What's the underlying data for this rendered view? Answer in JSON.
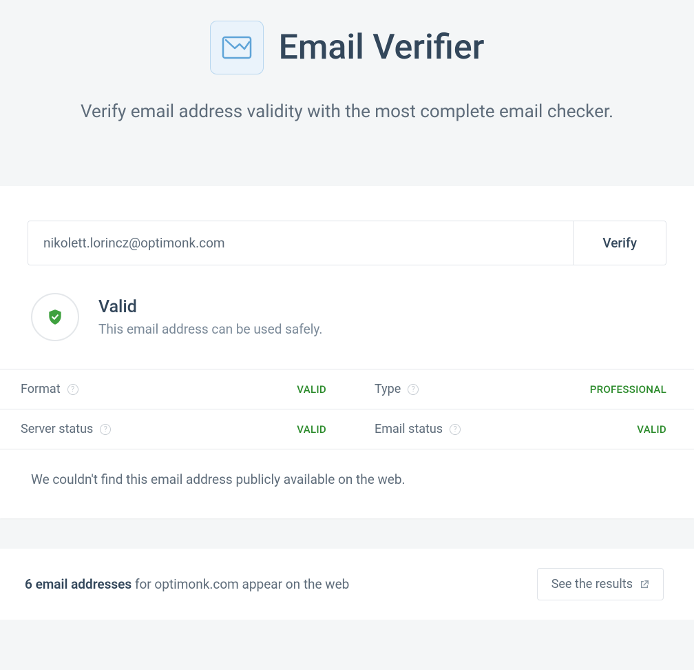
{
  "hero": {
    "title": "Email Verifier",
    "subtitle": "Verify email address validity with the most complete email checker."
  },
  "input": {
    "value": "nikolett.lorincz@optimonk.com",
    "verify_label": "Verify"
  },
  "status": {
    "title": "Valid",
    "desc": "This email address can be used safely."
  },
  "details": {
    "format": {
      "label": "Format",
      "value": "VALID"
    },
    "type": {
      "label": "Type",
      "value": "PROFESSIONAL"
    },
    "server": {
      "label": "Server status",
      "value": "VALID"
    },
    "email": {
      "label": "Email status",
      "value": "VALID"
    }
  },
  "notfound": "We couldn't find this email address publicly available on the web.",
  "footer": {
    "count": "6 email addresses",
    "rest": " for optimonk.com appear on the web",
    "button": "See the results"
  }
}
